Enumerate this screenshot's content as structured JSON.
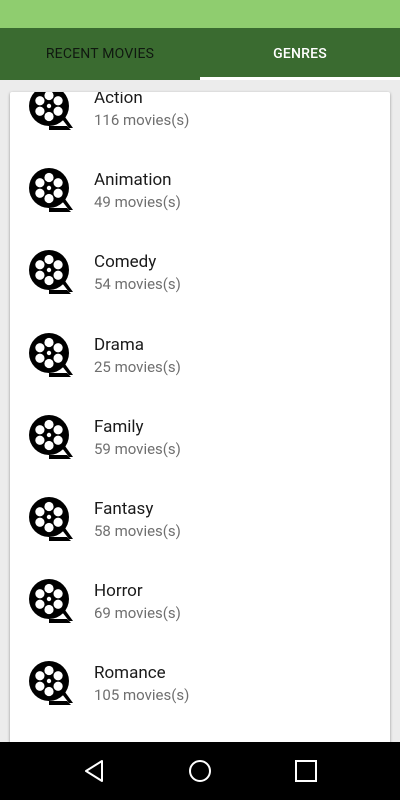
{
  "colors": {
    "status_bar": "#8fcd6f",
    "tab_bar": "#3a6b30",
    "tab_active_text": "#ffffff",
    "tab_inactive_text": "#101810",
    "indicator": "#ffffff",
    "card_bg": "#ffffff",
    "genre_name": "#1a1a1a",
    "genre_count": "#6f6f6f",
    "nav_bar": "#000000"
  },
  "tabs": [
    {
      "label": "RECENT MOVIES",
      "active": false
    },
    {
      "label": "GENRES",
      "active": true
    }
  ],
  "genres": [
    {
      "name": "Action",
      "count": "116 movies(s)",
      "icon": "film-reel-icon"
    },
    {
      "name": "Animation",
      "count": "49 movies(s)",
      "icon": "film-reel-icon"
    },
    {
      "name": "Comedy",
      "count": "54 movies(s)",
      "icon": "film-reel-icon"
    },
    {
      "name": "Drama",
      "count": "25 movies(s)",
      "icon": "film-reel-icon"
    },
    {
      "name": "Family",
      "count": "59 movies(s)",
      "icon": "film-reel-icon"
    },
    {
      "name": "Fantasy",
      "count": "58 movies(s)",
      "icon": "film-reel-icon"
    },
    {
      "name": "Horror",
      "count": "69 movies(s)",
      "icon": "film-reel-icon"
    },
    {
      "name": "Romance",
      "count": "105 movies(s)",
      "icon": "film-reel-icon"
    }
  ],
  "nav": {
    "back_icon": "back-triangle-icon",
    "home_icon": "home-circle-icon",
    "recents_icon": "recents-square-icon"
  }
}
